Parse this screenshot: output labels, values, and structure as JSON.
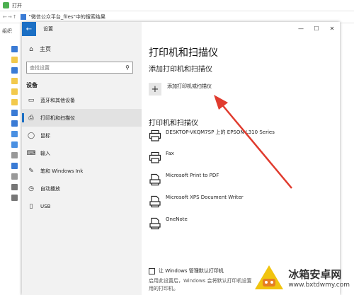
{
  "background": {
    "window_title": "打开",
    "address_text": "\"微信公众平台_files\"中的搜索结果",
    "left_label": "组织"
  },
  "settings": {
    "title": "设置",
    "home_label": "主页",
    "search_placeholder": "查找设置",
    "section_header": "设备",
    "nav_items": [
      {
        "label": "蓝牙和其他设备",
        "icon": "bluetooth-devices-icon"
      },
      {
        "label": "打印机和扫描仪",
        "icon": "printer-icon",
        "active": true
      },
      {
        "label": "鼠标",
        "icon": "mouse-icon"
      },
      {
        "label": "输入",
        "icon": "keyboard-icon"
      },
      {
        "label": "笔和 Windows Ink",
        "icon": "pen-icon"
      },
      {
        "label": "自动播放",
        "icon": "autoplay-icon"
      },
      {
        "label": "USB",
        "icon": "usb-icon"
      }
    ],
    "window_controls": [
      "—",
      "☐",
      "✕"
    ]
  },
  "main": {
    "page_title": "打印机和扫描仪",
    "add_section_title": "添加打印机和扫描仪",
    "add_button_label": "添加打印机或扫描仪",
    "printers_section_title": "打印机和扫描仪",
    "printers": [
      {
        "name": "DESKTOP-VKQM7SP 上的 EPSON L310 Series"
      },
      {
        "name": "Fax"
      },
      {
        "name": "Microsoft Print to PDF"
      },
      {
        "name": "Microsoft XPS Document Writer"
      },
      {
        "name": "OneNote"
      }
    ],
    "default_checkbox_label": "让 Windows 管理默认打印机",
    "default_checkbox_checked": false,
    "description_line1": "启用此设置后，Windows 会将默认打印机设置",
    "description_line2": "用的打印机。"
  },
  "watermark": {
    "title": "冰箱安卓网",
    "url": "www.bxtdwmy.com"
  },
  "colors": {
    "accent": "#1b6fc4",
    "arrow": "#e03b2e",
    "sidebar_bg": "#f2f2f2"
  }
}
